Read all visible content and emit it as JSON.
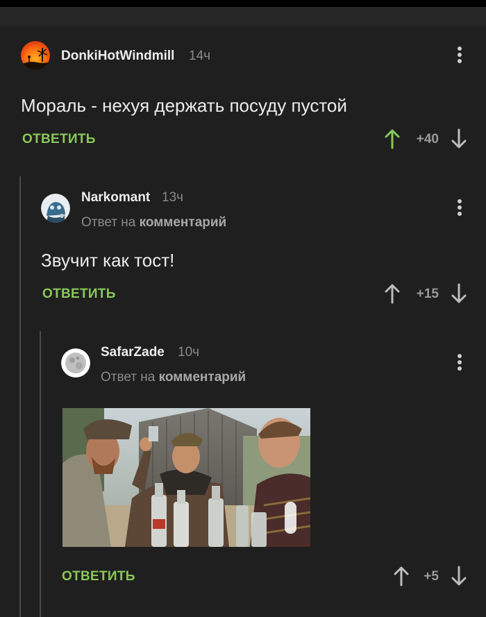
{
  "comments": [
    {
      "author": "DonkiHotWindmill",
      "time": "14ч",
      "text": "Мораль - нехуя держать посуду пустой",
      "reply_label": "ОТВЕТИТЬ",
      "score": "+40",
      "upvoted": true
    },
    {
      "author": "Narkomant",
      "time": "13ч",
      "reply_to_prefix": "Ответ на",
      "reply_to_link": "комментарий",
      "text": "Звучит как тост!",
      "reply_label": "ОТВЕТИТЬ",
      "score": "+15",
      "upvoted": false
    },
    {
      "author": "SafarZade",
      "time": "10ч",
      "reply_to_prefix": "Ответ на",
      "reply_to_link": "комментарий",
      "reply_label": "ОТВЕТИТЬ",
      "score": "+5",
      "upvoted": false
    }
  ],
  "icons": {
    "more": "more-vertical-icon",
    "up": "arrow-up-icon",
    "down": "arrow-down-icon"
  },
  "colors": {
    "background": "#1f1f1f",
    "accent_green": "#8ac858",
    "muted": "#8a8a8a"
  }
}
